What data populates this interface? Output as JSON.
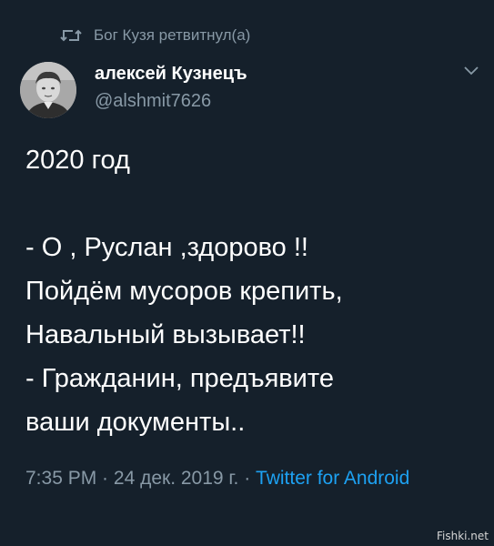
{
  "retweet": {
    "icon": "retweet-icon",
    "text": "Бог Кузя ретвитнул(а)"
  },
  "author": {
    "name": "алексей Кузнецъ",
    "handle": "@alshmit7626",
    "avatar": "avatar-photo"
  },
  "menu": {
    "icon": "chevron-down-icon"
  },
  "tweet": {
    "lines": [
      "2020 год",
      "",
      "- О , Руслан ,здорово !!",
      "Пойдём мусоров крепить,",
      "Навальный вызывает!!",
      "- Гражданин, предъявите",
      "ваши документы.."
    ]
  },
  "meta": {
    "time": "7:35 PM",
    "separator": " · ",
    "date": "24 дек. 2019 г.",
    "source": "Twitter for Android"
  },
  "watermark": "Fishki.net",
  "colors": {
    "background": "#15202b",
    "secondary_text": "#8899a6",
    "link": "#1da1f2"
  }
}
